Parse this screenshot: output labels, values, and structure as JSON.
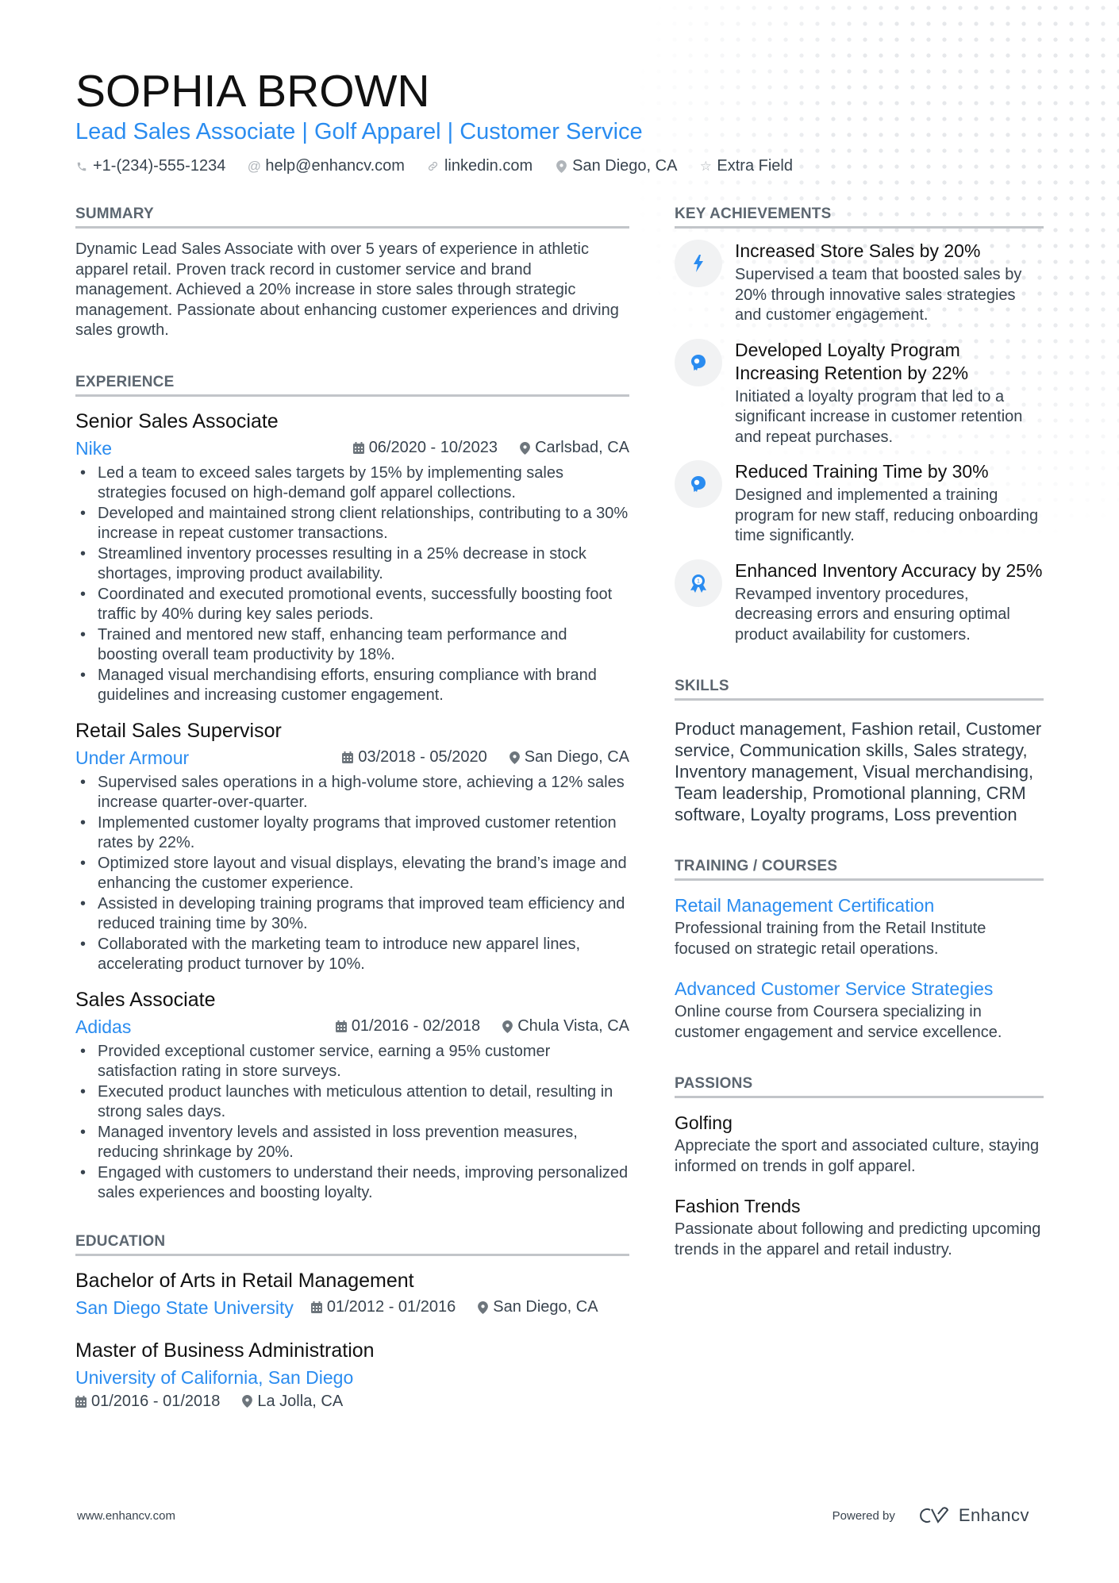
{
  "header": {
    "name": "SOPHIA BROWN",
    "subtitle": "Lead Sales Associate | Golf Apparel | Customer Service",
    "contacts": [
      {
        "icon": "phone-icon",
        "text": "+1-(234)-555-1234"
      },
      {
        "icon": "at-icon",
        "text": "help@enhancv.com"
      },
      {
        "icon": "link-icon",
        "text": "linkedin.com"
      },
      {
        "icon": "location-icon",
        "text": "San Diego, CA"
      },
      {
        "icon": "star-icon",
        "text": "Extra Field"
      }
    ]
  },
  "summary": {
    "title": "SUMMARY",
    "text": "Dynamic Lead Sales Associate with over 5 years of experience in athletic apparel retail. Proven track record in customer service and brand management. Achieved a 20% increase in store sales through strategic management. Passionate about enhancing customer experiences and driving sales growth."
  },
  "experience": {
    "title": "EXPERIENCE",
    "jobs": [
      {
        "title": "Senior Sales Associate",
        "company": "Nike",
        "dates": "06/2020 - 10/2023",
        "location": "Carlsbad, CA",
        "bullets": [
          "Led a team to exceed sales targets by 15% by implementing sales strategies focused on high-demand golf apparel collections.",
          "Developed and maintained strong client relationships, contributing to a 30% increase in repeat customer transactions.",
          "Streamlined inventory processes resulting in a 25% decrease in stock shortages, improving product availability.",
          "Coordinated and executed promotional events, successfully boosting foot traffic by 40% during key sales periods.",
          "Trained and mentored new staff, enhancing team performance and boosting overall team productivity by 18%.",
          "Managed visual merchandising efforts, ensuring compliance with brand guidelines and increasing customer engagement."
        ]
      },
      {
        "title": "Retail Sales Supervisor",
        "company": "Under Armour",
        "dates": "03/2018 - 05/2020",
        "location": "San Diego, CA",
        "bullets": [
          "Supervised sales operations in a high-volume store, achieving a 12% sales increase quarter-over-quarter.",
          "Implemented customer loyalty programs that improved customer retention rates by 22%.",
          "Optimized store layout and visual displays, elevating the brand’s image and enhancing the customer experience.",
          "Assisted in developing training programs that improved team efficiency and reduced training time by 30%.",
          "Collaborated with the marketing team to introduce new apparel lines, accelerating product turnover by 10%."
        ]
      },
      {
        "title": "Sales Associate",
        "company": "Adidas",
        "dates": "01/2016 - 02/2018",
        "location": "Chula Vista, CA",
        "bullets": [
          "Provided exceptional customer service, earning a 95% customer satisfaction rating in store surveys.",
          "Executed product launches with meticulous attention to detail, resulting in strong sales days.",
          "Managed inventory levels and assisted in loss prevention measures, reducing shrinkage by 20%.",
          "Engaged with customers to understand their needs, improving personalized sales experiences and boosting loyalty."
        ]
      }
    ]
  },
  "education": {
    "title": "EDUCATION",
    "items": [
      {
        "degree": "Bachelor of Arts in Retail Management",
        "school": "San Diego State University",
        "dates": "01/2012 - 01/2016",
        "location": "San Diego, CA"
      },
      {
        "degree": "Master of Business Administration",
        "school": "University of California, San Diego",
        "dates": "01/2016 - 01/2018",
        "location": "La Jolla, CA"
      }
    ]
  },
  "achievements": {
    "title": "KEY ACHIEVEMENTS",
    "items": [
      {
        "icon": "lightning-icon",
        "title": "Increased Store Sales by 20%",
        "desc": "Supervised a team that boosted sales by 20% through innovative sales strategies and customer engagement."
      },
      {
        "icon": "head-icon",
        "title": "Developed Loyalty Program Increasing Retention by 22%",
        "desc": "Initiated a loyalty program that led to a significant increase in customer retention and repeat purchases."
      },
      {
        "icon": "head-icon",
        "title": "Reduced Training Time by 30%",
        "desc": "Designed and implemented a training program for new staff, reducing onboarding time significantly."
      },
      {
        "icon": "award-icon",
        "title": "Enhanced Inventory Accuracy by 25%",
        "desc": "Revamped inventory procedures, decreasing errors and ensuring optimal product availability for customers."
      }
    ]
  },
  "skills": {
    "title": "SKILLS",
    "text": "Product management, Fashion retail, Customer service, Communication skills, Sales strategy, Inventory management, Visual merchandising, Team leadership, Promotional planning, CRM software, Loyalty programs, Loss prevention"
  },
  "training": {
    "title": "TRAINING / COURSES",
    "items": [
      {
        "title": "Retail Management Certification",
        "desc": "Professional training from the Retail Institute focused on strategic retail operations."
      },
      {
        "title": "Advanced Customer Service Strategies",
        "desc": "Online course from Coursera specializing in customer engagement and service excellence."
      }
    ]
  },
  "passions": {
    "title": "PASSIONS",
    "items": [
      {
        "title": "Golfing",
        "desc": "Appreciate the sport and associated culture, staying informed on trends in golf apparel."
      },
      {
        "title": "Fashion Trends",
        "desc": "Passionate about following and predicting upcoming trends in the apparel and retail industry."
      }
    ]
  },
  "footer": {
    "url": "www.enhancv.com",
    "powered_by": "Powered by",
    "brand": "Enhancv"
  },
  "colors": {
    "accent": "#2a8cf0",
    "text": "#38434e",
    "heading": "#111111",
    "rule": "#c2c5c9",
    "icon_bg": "#f1f2f3"
  }
}
